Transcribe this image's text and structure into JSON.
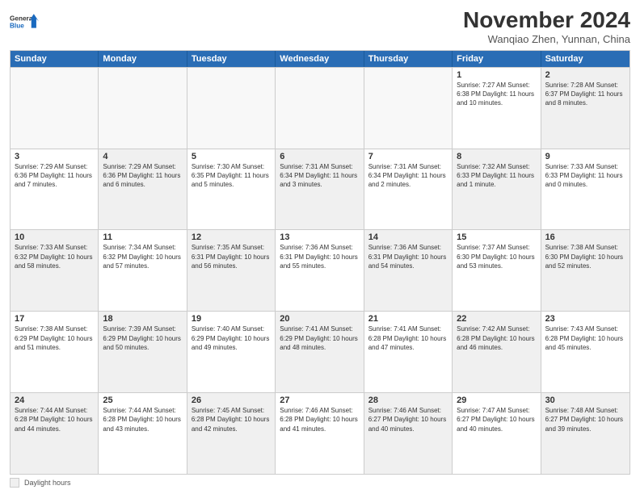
{
  "logo": {
    "general": "General",
    "blue": "Blue"
  },
  "title": "November 2024",
  "location": "Wanqiao Zhen, Yunnan, China",
  "days_of_week": [
    "Sunday",
    "Monday",
    "Tuesday",
    "Wednesday",
    "Thursday",
    "Friday",
    "Saturday"
  ],
  "weeks": [
    [
      {
        "day": "",
        "info": "",
        "shaded": false,
        "empty": true
      },
      {
        "day": "",
        "info": "",
        "shaded": false,
        "empty": true
      },
      {
        "day": "",
        "info": "",
        "shaded": false,
        "empty": true
      },
      {
        "day": "",
        "info": "",
        "shaded": false,
        "empty": true
      },
      {
        "day": "",
        "info": "",
        "shaded": false,
        "empty": true
      },
      {
        "day": "1",
        "info": "Sunrise: 7:27 AM\nSunset: 6:38 PM\nDaylight: 11 hours and 10 minutes.",
        "shaded": false,
        "empty": false
      },
      {
        "day": "2",
        "info": "Sunrise: 7:28 AM\nSunset: 6:37 PM\nDaylight: 11 hours and 8 minutes.",
        "shaded": true,
        "empty": false
      }
    ],
    [
      {
        "day": "3",
        "info": "Sunrise: 7:29 AM\nSunset: 6:36 PM\nDaylight: 11 hours and 7 minutes.",
        "shaded": false,
        "empty": false
      },
      {
        "day": "4",
        "info": "Sunrise: 7:29 AM\nSunset: 6:36 PM\nDaylight: 11 hours and 6 minutes.",
        "shaded": true,
        "empty": false
      },
      {
        "day": "5",
        "info": "Sunrise: 7:30 AM\nSunset: 6:35 PM\nDaylight: 11 hours and 5 minutes.",
        "shaded": false,
        "empty": false
      },
      {
        "day": "6",
        "info": "Sunrise: 7:31 AM\nSunset: 6:34 PM\nDaylight: 11 hours and 3 minutes.",
        "shaded": true,
        "empty": false
      },
      {
        "day": "7",
        "info": "Sunrise: 7:31 AM\nSunset: 6:34 PM\nDaylight: 11 hours and 2 minutes.",
        "shaded": false,
        "empty": false
      },
      {
        "day": "8",
        "info": "Sunrise: 7:32 AM\nSunset: 6:33 PM\nDaylight: 11 hours and 1 minute.",
        "shaded": true,
        "empty": false
      },
      {
        "day": "9",
        "info": "Sunrise: 7:33 AM\nSunset: 6:33 PM\nDaylight: 11 hours and 0 minutes.",
        "shaded": false,
        "empty": false
      }
    ],
    [
      {
        "day": "10",
        "info": "Sunrise: 7:33 AM\nSunset: 6:32 PM\nDaylight: 10 hours and 58 minutes.",
        "shaded": true,
        "empty": false
      },
      {
        "day": "11",
        "info": "Sunrise: 7:34 AM\nSunset: 6:32 PM\nDaylight: 10 hours and 57 minutes.",
        "shaded": false,
        "empty": false
      },
      {
        "day": "12",
        "info": "Sunrise: 7:35 AM\nSunset: 6:31 PM\nDaylight: 10 hours and 56 minutes.",
        "shaded": true,
        "empty": false
      },
      {
        "day": "13",
        "info": "Sunrise: 7:36 AM\nSunset: 6:31 PM\nDaylight: 10 hours and 55 minutes.",
        "shaded": false,
        "empty": false
      },
      {
        "day": "14",
        "info": "Sunrise: 7:36 AM\nSunset: 6:31 PM\nDaylight: 10 hours and 54 minutes.",
        "shaded": true,
        "empty": false
      },
      {
        "day": "15",
        "info": "Sunrise: 7:37 AM\nSunset: 6:30 PM\nDaylight: 10 hours and 53 minutes.",
        "shaded": false,
        "empty": false
      },
      {
        "day": "16",
        "info": "Sunrise: 7:38 AM\nSunset: 6:30 PM\nDaylight: 10 hours and 52 minutes.",
        "shaded": true,
        "empty": false
      }
    ],
    [
      {
        "day": "17",
        "info": "Sunrise: 7:38 AM\nSunset: 6:29 PM\nDaylight: 10 hours and 51 minutes.",
        "shaded": false,
        "empty": false
      },
      {
        "day": "18",
        "info": "Sunrise: 7:39 AM\nSunset: 6:29 PM\nDaylight: 10 hours and 50 minutes.",
        "shaded": true,
        "empty": false
      },
      {
        "day": "19",
        "info": "Sunrise: 7:40 AM\nSunset: 6:29 PM\nDaylight: 10 hours and 49 minutes.",
        "shaded": false,
        "empty": false
      },
      {
        "day": "20",
        "info": "Sunrise: 7:41 AM\nSunset: 6:29 PM\nDaylight: 10 hours and 48 minutes.",
        "shaded": true,
        "empty": false
      },
      {
        "day": "21",
        "info": "Sunrise: 7:41 AM\nSunset: 6:28 PM\nDaylight: 10 hours and 47 minutes.",
        "shaded": false,
        "empty": false
      },
      {
        "day": "22",
        "info": "Sunrise: 7:42 AM\nSunset: 6:28 PM\nDaylight: 10 hours and 46 minutes.",
        "shaded": true,
        "empty": false
      },
      {
        "day": "23",
        "info": "Sunrise: 7:43 AM\nSunset: 6:28 PM\nDaylight: 10 hours and 45 minutes.",
        "shaded": false,
        "empty": false
      }
    ],
    [
      {
        "day": "24",
        "info": "Sunrise: 7:44 AM\nSunset: 6:28 PM\nDaylight: 10 hours and 44 minutes.",
        "shaded": true,
        "empty": false
      },
      {
        "day": "25",
        "info": "Sunrise: 7:44 AM\nSunset: 6:28 PM\nDaylight: 10 hours and 43 minutes.",
        "shaded": false,
        "empty": false
      },
      {
        "day": "26",
        "info": "Sunrise: 7:45 AM\nSunset: 6:28 PM\nDaylight: 10 hours and 42 minutes.",
        "shaded": true,
        "empty": false
      },
      {
        "day": "27",
        "info": "Sunrise: 7:46 AM\nSunset: 6:28 PM\nDaylight: 10 hours and 41 minutes.",
        "shaded": false,
        "empty": false
      },
      {
        "day": "28",
        "info": "Sunrise: 7:46 AM\nSunset: 6:27 PM\nDaylight: 10 hours and 40 minutes.",
        "shaded": true,
        "empty": false
      },
      {
        "day": "29",
        "info": "Sunrise: 7:47 AM\nSunset: 6:27 PM\nDaylight: 10 hours and 40 minutes.",
        "shaded": false,
        "empty": false
      },
      {
        "day": "30",
        "info": "Sunrise: 7:48 AM\nSunset: 6:27 PM\nDaylight: 10 hours and 39 minutes.",
        "shaded": true,
        "empty": false
      }
    ]
  ],
  "legend": {
    "label": "Daylight hours"
  }
}
